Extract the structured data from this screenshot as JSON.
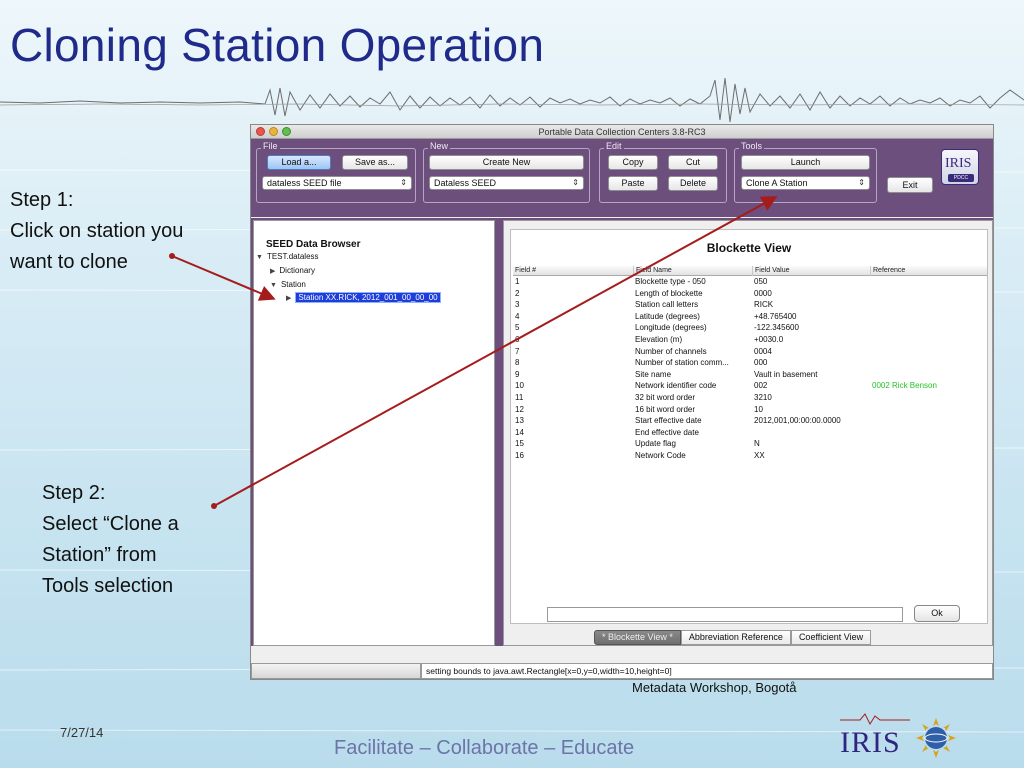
{
  "slide": {
    "title": "Cloning Station Operation",
    "step1": {
      "heading": "Step 1:",
      "line1": "Click on station you",
      "line2": "want to clone"
    },
    "step2": {
      "heading": "Step 2:",
      "line1": "Select “Clone a",
      "line2": "Station” from",
      "line3": "Tools selection"
    },
    "caption": "Metadata Workshop, Bogotå",
    "date": "7/27/14",
    "footer": "Facilitate – Collaborate – Educate",
    "logo_text": "IRIS"
  },
  "colors": {
    "title": "#1f2a8a",
    "toolbar_bg": "#6d4f7e",
    "selection": "#1d3edb",
    "arrow": "#a51c1c",
    "reference_text": "#22c322"
  },
  "app": {
    "title": "Portable Data Collection Centers 3.8-RC3",
    "groups": {
      "file": {
        "label": "File",
        "load": "Load a...",
        "save": "Save as...",
        "select": "dataless SEED file"
      },
      "new": {
        "label": "New",
        "create": "Create New",
        "select": "Dataless SEED"
      },
      "edit": {
        "label": "Edit",
        "copy": "Copy",
        "cut": "Cut",
        "paste": "Paste",
        "delete": "Delete"
      },
      "tools": {
        "label": "Tools",
        "launch": "Launch",
        "select": "Clone A Station"
      }
    },
    "exit": "Exit",
    "logo": {
      "word": "IRIS",
      "badge": "PDCC"
    },
    "tree": {
      "title": "SEED Data Browser",
      "root": "TEST.dataless",
      "dictionary": "Dictionary",
      "station": "Station",
      "station_item": "Station XX.RICK, 2012_001_00_00_00"
    },
    "blockette": {
      "title": "Blockette View",
      "columns": [
        "Field #",
        "Field Name",
        "Field Value",
        "Reference"
      ],
      "rows": [
        [
          "1",
          "Blockette type - 050",
          "050",
          ""
        ],
        [
          "2",
          "Length of blockette",
          "0000",
          ""
        ],
        [
          "3",
          "Station call letters",
          "RICK",
          ""
        ],
        [
          "4",
          "Latitude (degrees)",
          "+48.765400",
          ""
        ],
        [
          "5",
          "Longitude (degrees)",
          "-122.345600",
          ""
        ],
        [
          "6",
          "Elevation (m)",
          "+0030.0",
          ""
        ],
        [
          "7",
          "Number of channels",
          "0004",
          ""
        ],
        [
          "8",
          "Number of station comm...",
          "000",
          ""
        ],
        [
          "9",
          "Site name",
          "Vault in basement",
          ""
        ],
        [
          "10",
          "Network identifier code",
          "002",
          "0002 Rick Benson"
        ],
        [
          "11",
          "32 bit word order",
          "3210",
          ""
        ],
        [
          "12",
          "16 bit word order",
          "10",
          ""
        ],
        [
          "13",
          "Start effective date",
          "2012,001,00:00:00.0000",
          ""
        ],
        [
          "14",
          "End effective date",
          "",
          ""
        ],
        [
          "15",
          "Update flag",
          "N",
          ""
        ],
        [
          "16",
          "Network Code",
          "XX",
          ""
        ]
      ],
      "ok": "Ok"
    },
    "tabs": [
      "* Blockette View *",
      "Abbreviation Reference",
      "Coefficient View"
    ],
    "status": "setting bounds to java.awt.Rectangle[x=0,y=0,width=10,height=0]"
  }
}
